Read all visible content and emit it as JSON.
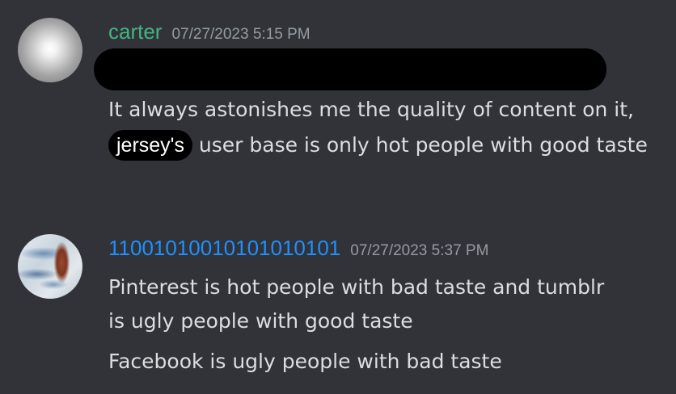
{
  "messages": [
    {
      "username": "carter",
      "timestamp": "07/27/2023 5:15 PM",
      "username_color": "#43b581",
      "text_before": "It always astonishes me the quality of content on it, ",
      "sticker": "jersey's",
      "text_after": " user base is only hot people with good taste"
    },
    {
      "username": "11001010010101010101",
      "timestamp": "07/27/2023 5:37 PM",
      "username_color": "#1e90ff",
      "lines": [
        "Pinterest is hot people with bad taste and tumblr",
        "is ugly people with good taste",
        "Facebook is ugly people with bad taste"
      ]
    }
  ],
  "colors": {
    "background": "#313338",
    "text": "#dbdee1",
    "timestamp": "#949ba4",
    "redaction": "#000000"
  },
  "icons": {
    "avatar_1": "white-glow-avatar",
    "avatar_2": "painted-artwork-avatar"
  }
}
